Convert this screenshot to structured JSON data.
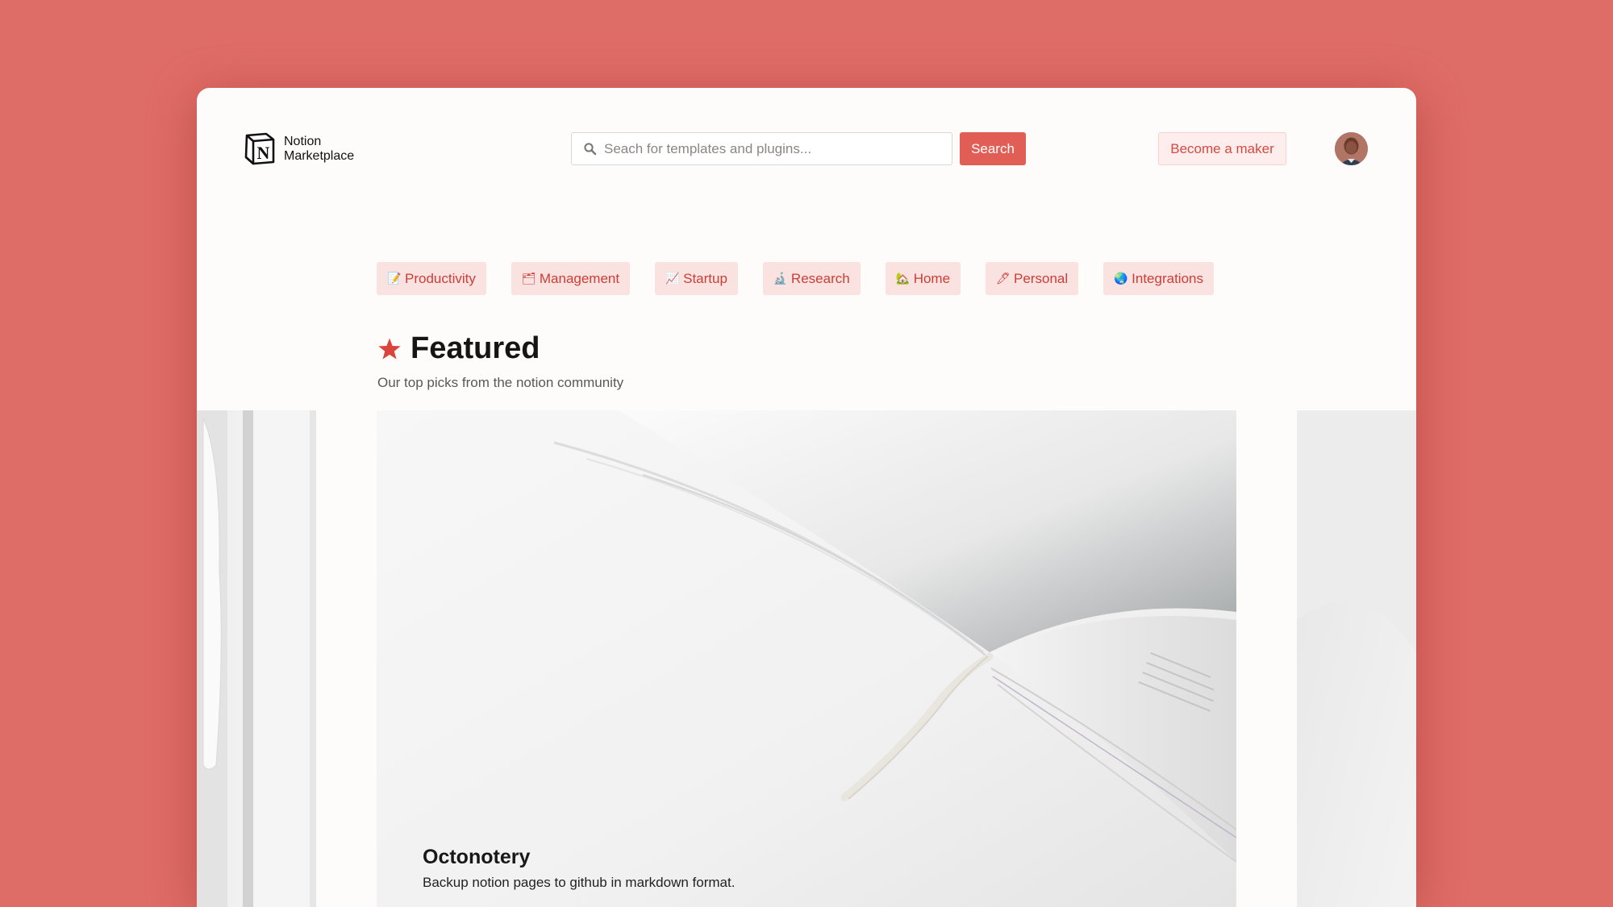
{
  "app": {
    "name_line1": "Notion",
    "name_line2": "Marketplace"
  },
  "search": {
    "placeholder": "Seach for templates and plugins...",
    "button_label": "Search"
  },
  "header": {
    "maker_label": "Become a maker"
  },
  "categories": [
    {
      "icon": "📝",
      "label": "Productivity"
    },
    {
      "icon": "🗂",
      "label": "Management"
    },
    {
      "icon": "📈",
      "label": "Startup"
    },
    {
      "icon": "🔬",
      "label": "Research"
    },
    {
      "icon": "🏡",
      "label": "Home"
    },
    {
      "icon": "🖊",
      "label": "Personal"
    },
    {
      "icon": "🌏",
      "label": "Integrations"
    }
  ],
  "featured": {
    "title": "Featured",
    "subtitle": "Our top picks from the notion community"
  },
  "card": {
    "title": "Octonotery",
    "description": "Backup notion pages to github in markdown format."
  },
  "colors": {
    "background": "#df6d67",
    "accent": "#e05e56",
    "chip_bg": "#fae2e0",
    "chip_text": "#cc3e36"
  }
}
